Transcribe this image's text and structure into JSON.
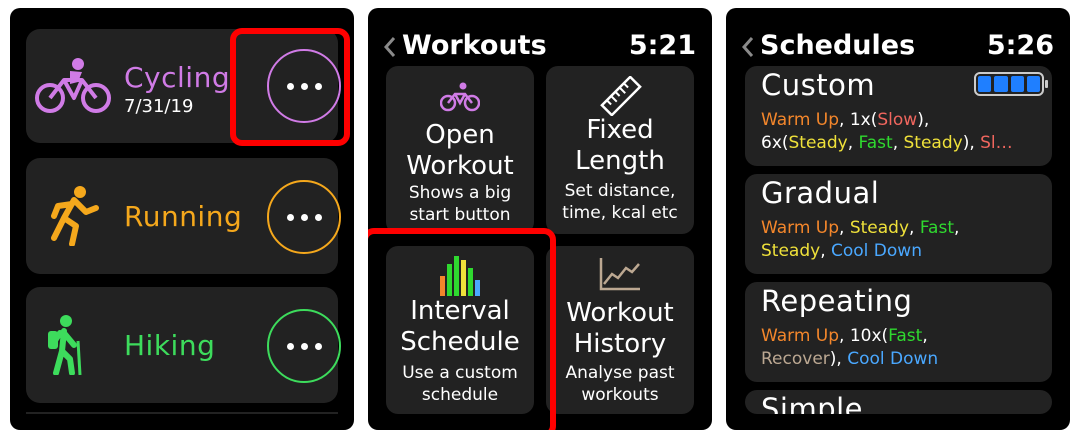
{
  "screen1": {
    "activities": [
      {
        "name": "Cycling",
        "date": "7/31/19",
        "color": "#d07be6",
        "icon": "cycling-icon"
      },
      {
        "name": "Running",
        "date": "",
        "color": "#f5a81c",
        "icon": "running-icon"
      },
      {
        "name": "Hiking",
        "date": "",
        "color": "#3ddc5c",
        "icon": "hiking-icon"
      }
    ],
    "highlight_color": "#ff0000"
  },
  "screen2": {
    "back": "<",
    "title": "Workouts",
    "time": "5:21",
    "tiles": [
      {
        "line1": "Open",
        "line2": "Workout",
        "sub1": "Shows a big",
        "sub2": "start button",
        "icon": "cycling-icon"
      },
      {
        "line1": "Fixed",
        "line2": "Length",
        "sub1": "Set distance,",
        "sub2": "time, kcal etc",
        "icon": "ruler-icon"
      },
      {
        "line1": "Interval",
        "line2": "Schedule",
        "sub1": "Use a custom",
        "sub2": "schedule",
        "icon": "interval-bars-icon"
      },
      {
        "line1": "Workout",
        "line2": "History",
        "sub1": "Analyse past",
        "sub2": "workouts",
        "icon": "line-chart-icon"
      }
    ]
  },
  "screen3": {
    "back": "<",
    "title": "Schedules",
    "time": "5:26",
    "schedules": [
      {
        "name": "Custom",
        "l1": {
          "a": "Warm Up",
          "b": ", 1x(",
          "c": "Slow",
          "d": "),"
        },
        "l2": {
          "a": "6x(",
          "b": "Steady",
          "c": ", ",
          "d": "Fast",
          "e": ", ",
          "f": "Steady",
          "g": "), ",
          "h": "Sl…"
        }
      },
      {
        "name": "Gradual",
        "l1": {
          "a": "Warm Up",
          "b": ", ",
          "c": "Steady",
          "d": ", ",
          "e": "Fast",
          "f": ","
        },
        "l2": {
          "a": "Steady",
          "b": ", ",
          "c": "Cool Down"
        }
      },
      {
        "name": "Repeating",
        "l1": {
          "a": "Warm Up",
          "b": ", 10x(",
          "c": "Fast",
          "d": ","
        },
        "l2": {
          "a": "Recover",
          "b": "), ",
          "c": "Cool Down"
        }
      },
      {
        "name": "Simple"
      }
    ]
  }
}
